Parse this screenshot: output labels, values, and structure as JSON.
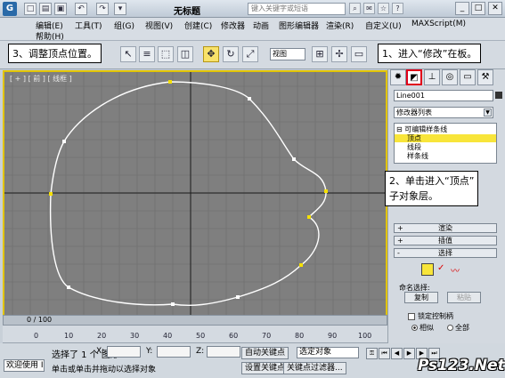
{
  "titlebar": {
    "title": "无标题",
    "search_placeholder": "键入关键字或短语",
    "quick_access": [
      "新建",
      "打开",
      "保存",
      "撤消",
      "重做"
    ],
    "window_controls": [
      "最小化",
      "还原",
      "关闭"
    ]
  },
  "menubar": {
    "items": [
      "编辑(E)",
      "工具(T)",
      "组(G)",
      "视图(V)",
      "创建(C)",
      "修改器",
      "动画",
      "图形编辑器",
      "渲染(R)",
      "自定义(U)",
      "MAXScript(M)",
      "帮助(H)"
    ]
  },
  "toolbar": {
    "view_select": "视图"
  },
  "callouts": {
    "step1": "1、进入“修改”在板。",
    "step2_line1": "2、单击进入“顶点”",
    "step2_line2": "子对象层。",
    "step3": "3、调整顶点位置。"
  },
  "viewport": {
    "label": "[ + ] [ 前 ] [ 线框 ]",
    "vertex_color": "#f5e000",
    "spline_color": "#ffffff",
    "border_color": "#e2c400"
  },
  "timeline": {
    "frame_text": "0 / 100",
    "ruler_ticks": [
      "0",
      "10",
      "20",
      "30",
      "40",
      "50",
      "60",
      "70",
      "80",
      "90",
      "100"
    ]
  },
  "statusbar": {
    "welcome": "欢迎使用 I",
    "selection": "选择了 1 个 图形",
    "message": "单击或单击并拖动以选择对象",
    "x_label": "X:",
    "y_label": "Y:",
    "z_label": "Z:",
    "auto_key": "自动关键点",
    "set_key": "设置关键点",
    "selected_object": "选定对象",
    "key_filters": "关键点过滤器..."
  },
  "command_panel": {
    "object_name": "Line001",
    "modifier_list": "修改器列表",
    "stack": {
      "root": "可编辑样条线",
      "items": [
        "顶点",
        "线段",
        "样条线"
      ],
      "selected": "顶点"
    },
    "rollouts": [
      "渲染",
      "插值",
      "选择"
    ],
    "named_selection": "命名选择:",
    "copy": "复制",
    "paste": "粘贴",
    "lock_handles": "锁定控制柄",
    "similar": "相似",
    "all": "全部"
  },
  "watermark": "Ps123.Net"
}
